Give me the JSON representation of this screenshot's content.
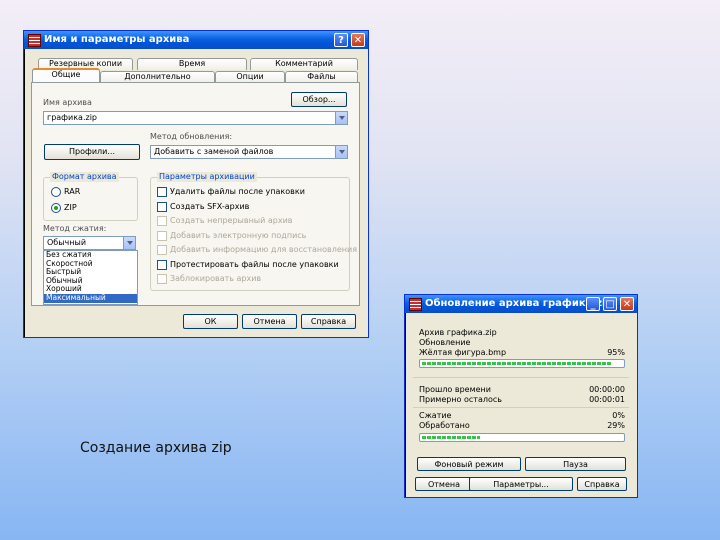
{
  "dialog1": {
    "title": "Имя и параметры архива",
    "title_buttons": {
      "help": "?",
      "close": "✕"
    },
    "tabs_row1": [
      "Резервные копии",
      "Время",
      "Комментарий"
    ],
    "tabs_row2": [
      "Общие",
      "Дополнительно",
      "Опции",
      "Файлы"
    ],
    "archive_name_label": "Имя архива",
    "browse_button": "Обзор...",
    "archive_name_value": "графика.zip",
    "update_method_label": "Метод обновления:",
    "profiles_button": "Профили...",
    "update_method_value": "Добавить с заменой файлов",
    "format_group_title": "Формат архива",
    "format_options": [
      "RAR",
      "ZIP"
    ],
    "format_selected": "ZIP",
    "compression_label": "Метод сжатия:",
    "compression_value": "Обычный",
    "compression_options": [
      "Без сжатия",
      "Скоростной",
      "Быстрый",
      "Обычный",
      "Хороший",
      "Максимальный"
    ],
    "compression_selected": "Максимальный",
    "params_group_title": "Параметры архивации",
    "params_options": [
      {
        "label": "Удалить файлы после упаковки",
        "enabled": true
      },
      {
        "label": "Создать SFX-архив",
        "enabled": true
      },
      {
        "label": "Создать непрерывный архив",
        "enabled": false
      },
      {
        "label": "Добавить электронную подпись",
        "enabled": false
      },
      {
        "label": "Добавить информацию для восстановления",
        "enabled": false
      },
      {
        "label": "Протестировать файлы после упаковки",
        "enabled": true
      },
      {
        "label": "Заблокировать архив",
        "enabled": false
      }
    ],
    "ok_button": "ОК",
    "cancel_button": "Отмена",
    "help_button": "Справка"
  },
  "dialog2": {
    "title": "Обновление архива графика.zip",
    "title_buttons": {
      "minimize": "_",
      "maximize": "□",
      "close": "✕"
    },
    "line1": "Архив графика.zip",
    "line2": "Обновление",
    "file_label": "Жёлтая фигура.bmp",
    "file_percent": "95%",
    "file_progress": 0.95,
    "elapsed_label": "Прошло времени",
    "elapsed_value": "00:00:00",
    "remaining_label": "Примерно осталось",
    "remaining_value": "00:00:01",
    "ratio_label": "Сжатие",
    "ratio_value": "0%",
    "processed_label": "Обработано",
    "processed_value": "29%",
    "total_progress": 0.29,
    "background_button": "Фоновый режим",
    "pause_button": "Пауза",
    "cancel_button": "Отмена",
    "params_button": "Параметры...",
    "help_button": "Справка"
  },
  "caption": "Создание архива zip"
}
